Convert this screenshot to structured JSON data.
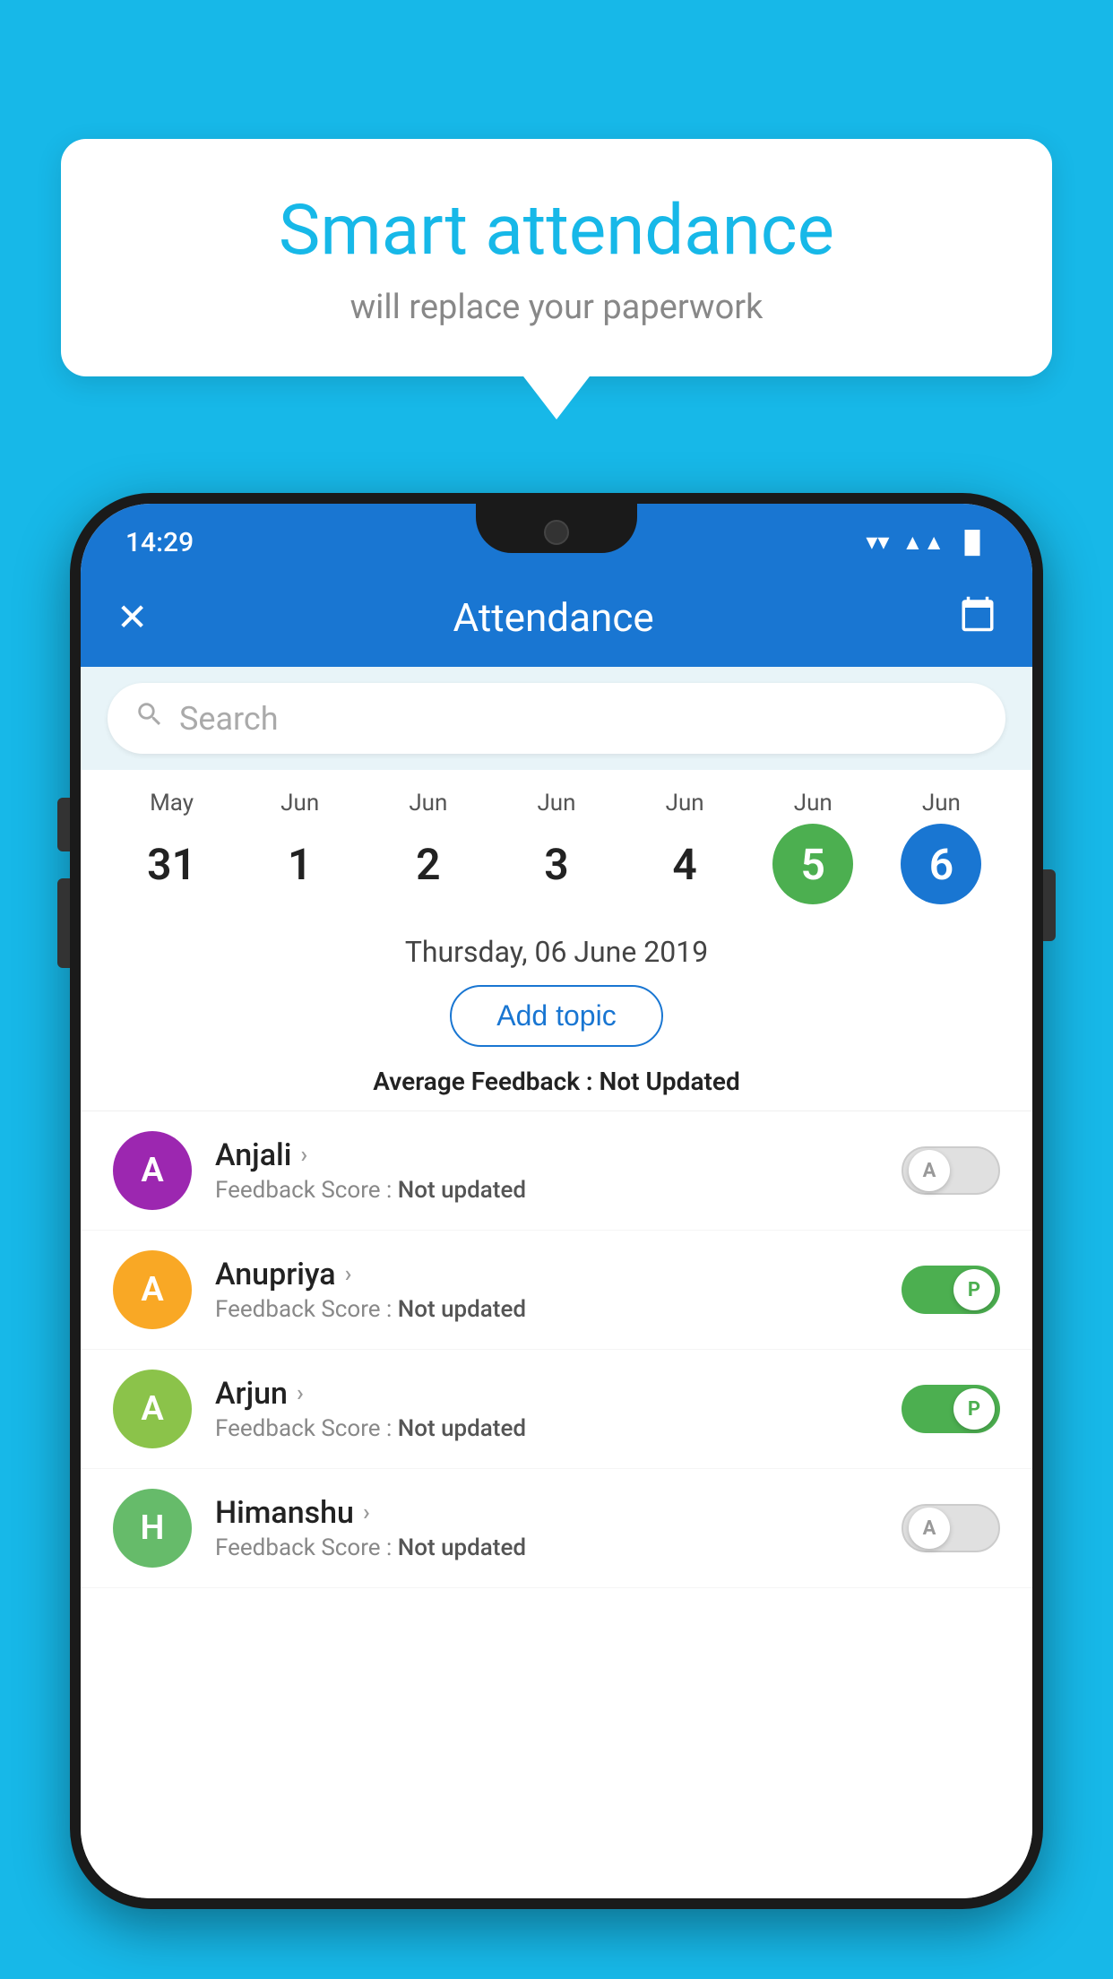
{
  "background_color": "#17b8e8",
  "speech_bubble": {
    "title": "Smart attendance",
    "subtitle": "will replace your paperwork"
  },
  "status_bar": {
    "time": "14:29",
    "wifi": "▼",
    "signal": "▲",
    "battery": "▌"
  },
  "header": {
    "title": "Attendance",
    "close_label": "✕",
    "calendar_label": "📅"
  },
  "search": {
    "placeholder": "Search"
  },
  "calendar": {
    "dates": [
      {
        "month": "May",
        "day": "31",
        "style": "normal"
      },
      {
        "month": "Jun",
        "day": "1",
        "style": "normal"
      },
      {
        "month": "Jun",
        "day": "2",
        "style": "normal"
      },
      {
        "month": "Jun",
        "day": "3",
        "style": "normal"
      },
      {
        "month": "Jun",
        "day": "4",
        "style": "normal"
      },
      {
        "month": "Jun",
        "day": "5",
        "style": "today"
      },
      {
        "month": "Jun",
        "day": "6",
        "style": "selected"
      }
    ]
  },
  "date_info": {
    "selected_date": "Thursday, 06 June 2019",
    "add_topic_label": "Add topic",
    "avg_feedback_label": "Average Feedback :",
    "avg_feedback_value": "Not Updated"
  },
  "students": [
    {
      "name": "Anjali",
      "initial": "A",
      "avatar_color": "purple",
      "feedback_label": "Feedback Score :",
      "feedback_value": "Not updated",
      "toggle_state": "off",
      "toggle_label": "A"
    },
    {
      "name": "Anupriya",
      "initial": "A",
      "avatar_color": "yellow",
      "feedback_label": "Feedback Score :",
      "feedback_value": "Not updated",
      "toggle_state": "on",
      "toggle_label": "P"
    },
    {
      "name": "Arjun",
      "initial": "A",
      "avatar_color": "green-light",
      "feedback_label": "Feedback Score :",
      "feedback_value": "Not updated",
      "toggle_state": "on",
      "toggle_label": "P"
    },
    {
      "name": "Himanshu",
      "initial": "H",
      "avatar_color": "green-dark",
      "feedback_label": "Feedback Score :",
      "feedback_value": "Not updated",
      "toggle_state": "off",
      "toggle_label": "A"
    }
  ]
}
